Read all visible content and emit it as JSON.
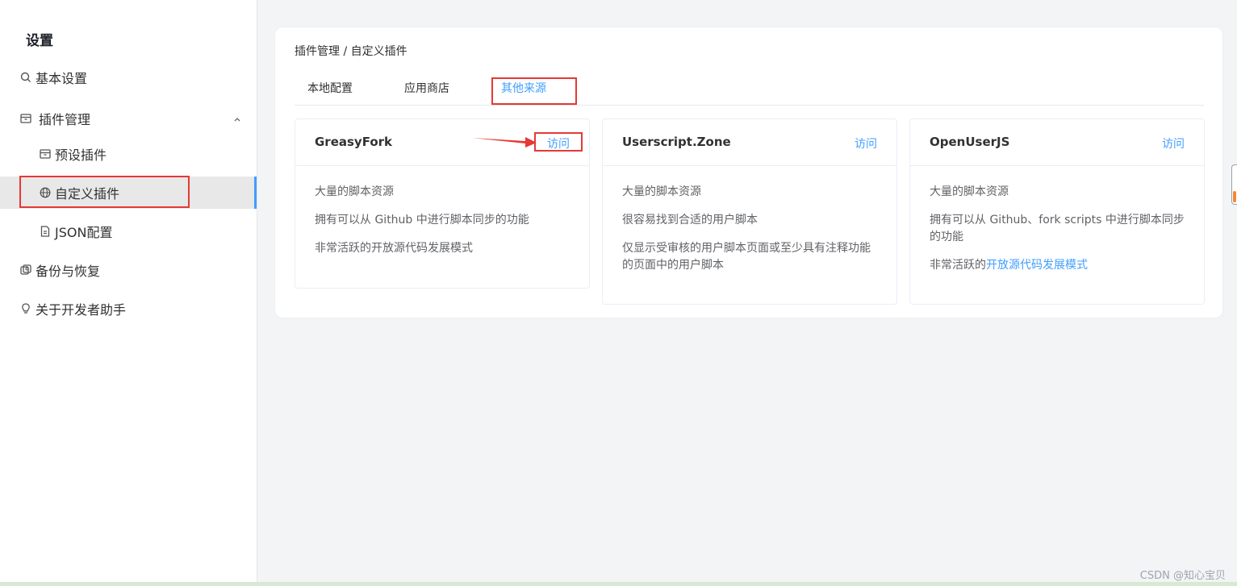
{
  "sidebar": {
    "title": "设置",
    "items": [
      {
        "label": "基本设置",
        "icon": "search-icon"
      },
      {
        "label": "插件管理",
        "icon": "box-icon",
        "expanded": true
      },
      {
        "label": "预设插件",
        "icon": "box-icon"
      },
      {
        "label": "自定义插件",
        "icon": "globe-icon",
        "active": true
      },
      {
        "label": "JSON配置",
        "icon": "document-icon"
      },
      {
        "label": "备份与恢复",
        "icon": "backup-icon"
      },
      {
        "label": "关于开发者助手",
        "icon": "lightbulb-icon"
      }
    ]
  },
  "main": {
    "breadcrumb": "插件管理 / 自定义插件",
    "tabs": [
      {
        "label": "本地配置"
      },
      {
        "label": "应用商店"
      },
      {
        "label": "其他来源",
        "active": true
      }
    ],
    "cards": [
      {
        "title": "GreasyFork",
        "visit_label": "访问",
        "features": [
          "大量的脚本资源",
          "拥有可以从 Github 中进行脚本同步的功能",
          "非常活跃的开放源代码发展模式"
        ]
      },
      {
        "title": "Userscript.Zone",
        "visit_label": "访问",
        "features": [
          "大量的脚本资源",
          "很容易找到合适的用户脚本",
          "仅显示受审核的用户脚本页面或至少具有注释功能的页面中的用户脚本"
        ]
      },
      {
        "title": "OpenUserJS",
        "visit_label": "访问",
        "features": [
          "大量的脚本资源",
          "拥有可以从 Github、fork scripts 中进行脚本同步的功能"
        ],
        "feature_prefix": "非常活跃的",
        "feature_link": "开放源代码发展模式"
      }
    ]
  },
  "watermark": "CSDN @知心宝贝",
  "colors": {
    "accent": "#409eff",
    "highlight": "#e53935",
    "active_menu_bg": "#e8e8e8",
    "page_bg": "#f3f4f6"
  }
}
